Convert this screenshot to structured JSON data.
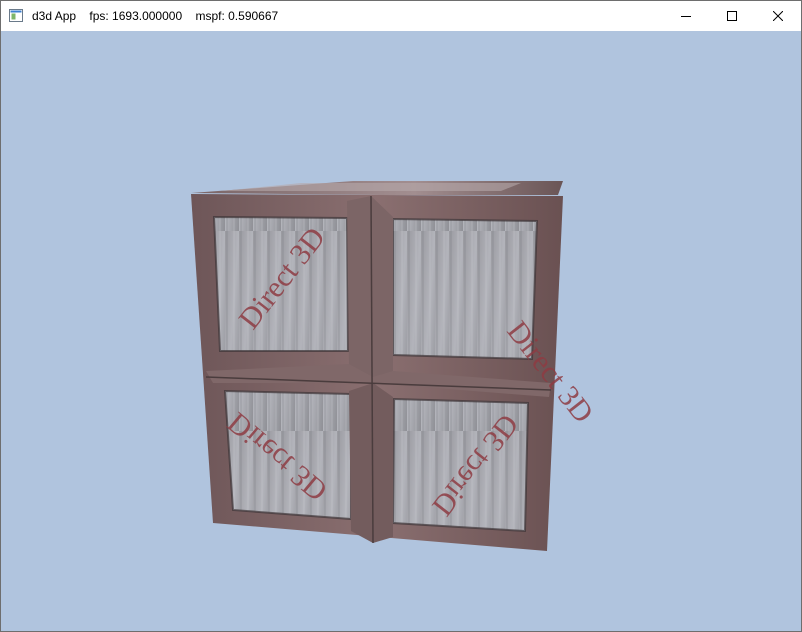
{
  "window": {
    "title": "d3d App    fps: 1693.000000    mspf: 0.590667",
    "icon": "app-window-icon",
    "buttons": {
      "minimize": "minimize-icon",
      "maximize": "maximize-icon",
      "close": "close-icon"
    }
  },
  "viewport": {
    "background": "#b0c4de",
    "object": "textured-crate-cube",
    "crate_label": "Direct 3D"
  }
}
